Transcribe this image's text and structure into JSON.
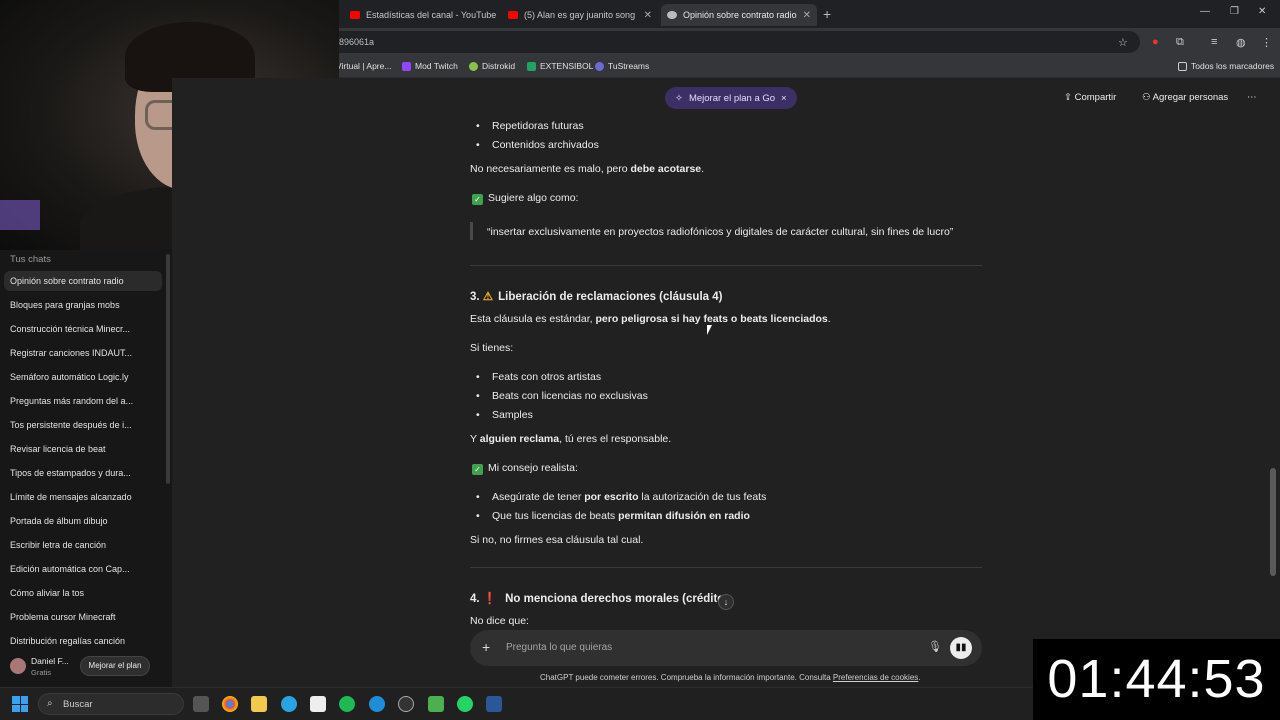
{
  "browser": {
    "tabs": [
      {
        "label": "Estadísticas del canal - YouTube",
        "fav_color": "#ff0000"
      },
      {
        "label": "(5) Alan es gay juanito song - YouTube",
        "fav_color": "#ff0000"
      },
      {
        "label": "Opinión sobre contrato radio",
        "fav_color": "#bbbbbb"
      }
    ],
    "url": "896061a",
    "bookmarks": [
      "Virtual | Apre...",
      "Mod Twitch",
      "Distrokid",
      "EXTENSIBOL",
      "TuStreams"
    ],
    "all_bookmarks": "Todos los marcadores"
  },
  "header": {
    "upgrade_pill": "Mejorar el plan a Go",
    "share": "Compartir",
    "add_people": "Agregar personas"
  },
  "sidebar": {
    "heading": "Tus chats",
    "chats": [
      "Opinión sobre contrato radio",
      "Bloques para granjas mobs",
      "Construcción técnica Minecr...",
      "Registrar canciones INDAUT...",
      "Semáforo automático Logic.ly",
      "Preguntas más random del a...",
      "Tos persistente después de i...",
      "Revisar licencia de beat",
      "Tipos de estampados y dura...",
      "Límite de mensajes alcanzado",
      "Portada de álbum dibujo",
      "Escribir letra de canción",
      "Edición automática con Cap...",
      "Cómo aliviar la tos",
      "Problema cursor Minecraft",
      "Distribución regalías canción"
    ],
    "user_name": "Daniel F...",
    "user_plan": "Gratis",
    "upgrade_button": "Mejorar el plan"
  },
  "message": {
    "bullets_top": [
      "Repetidoras futuras",
      "Contenidos archivados"
    ],
    "p1_a": "No necesariamente es malo, pero ",
    "p1_b": "debe acotarse",
    "p1_c": ".",
    "suggest": "Sugiere algo como:",
    "quote": "“insertar exclusivamente en proyectos radiofónicos y digitales de carácter cultural, sin fines de lucro”",
    "s3_num": "3.",
    "s3_title": "Liberación de reclamaciones (cláusula 4)",
    "p2_a": "Esta cláusula es estándar, ",
    "p2_b": "pero peligrosa si hay feats o beats licenciados",
    "p2_c": ".",
    "si_tienes": "Si tienes:",
    "bullets_mid": [
      "Feats con otros artistas",
      "Beats con licencias no exclusivas",
      "Samples"
    ],
    "p3_a": "Y ",
    "p3_b": "alguien reclama",
    "p3_c": ", tú eres el responsable.",
    "advice": "Mi consejo realista:",
    "b4_a": "Asegúrate de tener ",
    "b4_b": "por escrito",
    "b4_c": " la autorización de tus feats",
    "b5_a": "Que tus licencias de beats ",
    "b5_b": "permitan difusión en radio",
    "p4": "Si no, no firmes esa cláusula tal cual.",
    "s4_num": "4.",
    "s4_title": "No menciona derechos morales (crédito",
    "p5": "No dice que:"
  },
  "composer": {
    "placeholder": "Pregunta lo que quieras",
    "disclaimer": "ChatGPT puede cometer errores. Comprueba la información importante. Consulta ",
    "disclaimer_link": "Preferencias de cookies",
    "disclaimer_end": "."
  },
  "taskbar": {
    "search": "Buscar"
  },
  "timer": "01:44:53"
}
